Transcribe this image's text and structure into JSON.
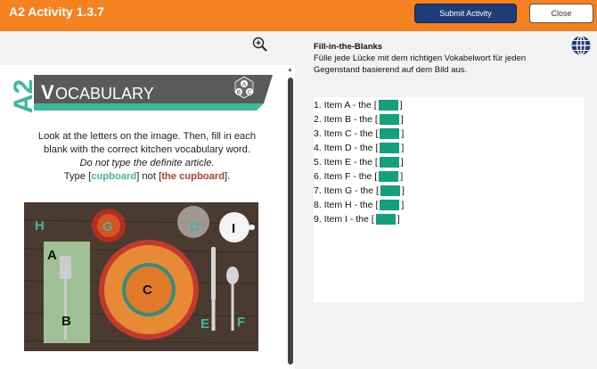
{
  "header": {
    "title": "A2 Activity 1.3.7",
    "submit_label": "Submit Activity",
    "close_label": "Close"
  },
  "worksheet": {
    "badge": "A2",
    "heading_initial": "V",
    "heading_rest": "OCABULARY",
    "cube_letters": [
      "A",
      "B",
      "C"
    ],
    "line1": "Look at the letters on the image. Then, fill in each",
    "line2": "blank with the correct kitchen vocabulary word.",
    "note": "Do not type the definite article.",
    "type_prefix": "Type [",
    "good_example": "cupboard",
    "middle": "] not [",
    "bad_example": "the cupboard",
    "type_suffix": "].",
    "photo_labels": [
      "H",
      "G",
      "D",
      "I",
      "A",
      "C",
      "B",
      "E",
      "F"
    ]
  },
  "exercise": {
    "title": "Fill-in-the-Blanks",
    "description": "Fülle jede Lücke mit dem richtigen Vokabelwort für jeden Gegenstand basierend auf dem Bild aus.",
    "items": [
      {
        "prefix": "1. Item A - the [",
        "suffix": "]"
      },
      {
        "prefix": "2. Item B - the [",
        "suffix": "]"
      },
      {
        "prefix": "3. Item C - the [",
        "suffix": "]"
      },
      {
        "prefix": "4. Item D - the [",
        "suffix": "]"
      },
      {
        "prefix": "5. Item E - the [",
        "suffix": "]"
      },
      {
        "prefix": "6. Item F - the [",
        "suffix": "]"
      },
      {
        "prefix": "7. Item G - the [",
        "suffix": "]"
      },
      {
        "prefix": "8. Item H - the [",
        "suffix": "]"
      },
      {
        "prefix": "9. Item I - the [",
        "suffix": "]"
      }
    ]
  },
  "colors": {
    "topbar": "#f58220",
    "submit": "#1f3b78",
    "blank": "#13a07a",
    "accent_green": "#3fb8a0",
    "accent_red": "#c0392b"
  },
  "icons": [
    "zoom-in-icon",
    "globe-icon",
    "cube-icon",
    "scroll-up-icon"
  ]
}
